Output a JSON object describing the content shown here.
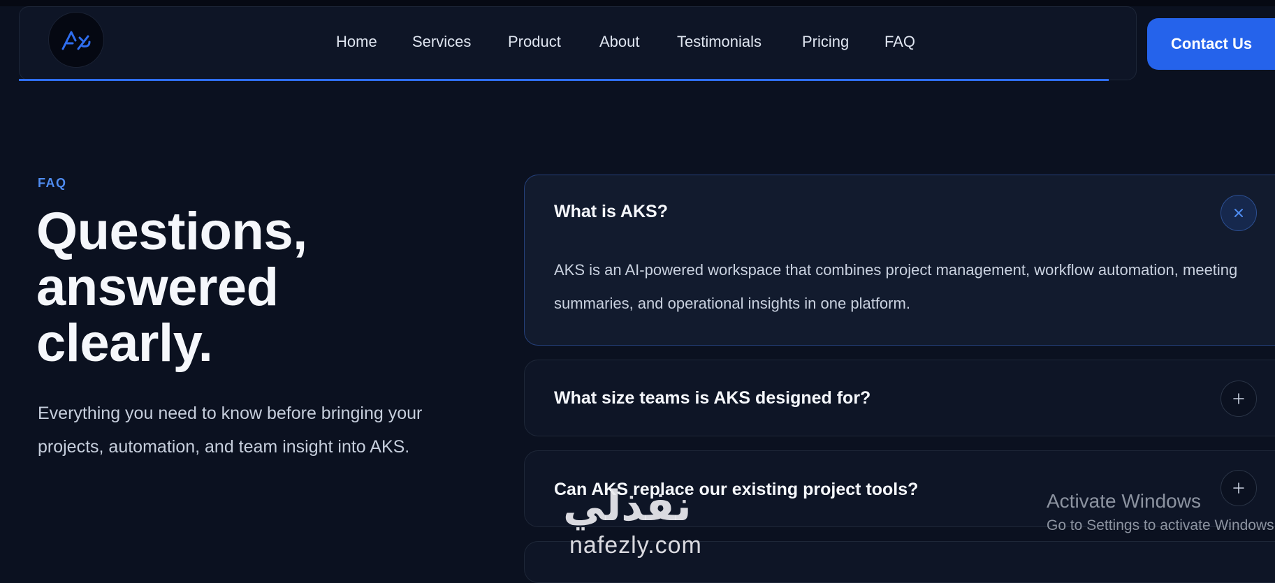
{
  "nav": {
    "logo_alt": "AKS",
    "links": [
      "Home",
      "Services",
      "Product",
      "About",
      "Testimonials",
      "Pricing",
      "FAQ"
    ],
    "contact_label": "Contact Us"
  },
  "intro": {
    "eyebrow": "FAQ",
    "headline_lines": [
      "Questions,",
      "answered",
      "clearly."
    ],
    "lead": "Everything you need to know before bringing your projects, automation, and team insight into AKS."
  },
  "faq": {
    "items": [
      {
        "question": "What is AKS?",
        "answer": "AKS is an AI-powered workspace that combines project management, workflow automation, meeting summaries, and operational insights in one platform.",
        "open": true
      },
      {
        "question": "What size teams is AKS designed for?",
        "answer": "",
        "open": false
      },
      {
        "question": "Can AKS replace our existing project tools?",
        "answer": "",
        "open": false
      }
    ]
  },
  "watermark": {
    "arabic": "نفذلي",
    "latin": "nafezly.com"
  },
  "windows_notice": {
    "title": "Activate Windows",
    "subtitle": "Go to Settings to activate Windows."
  },
  "colors": {
    "accent": "#2563eb",
    "background": "#0b1120",
    "eyebrow": "#4f8cf0"
  },
  "icons": {
    "open_toggle": "close-icon",
    "closed_toggle": "plus-icon"
  }
}
